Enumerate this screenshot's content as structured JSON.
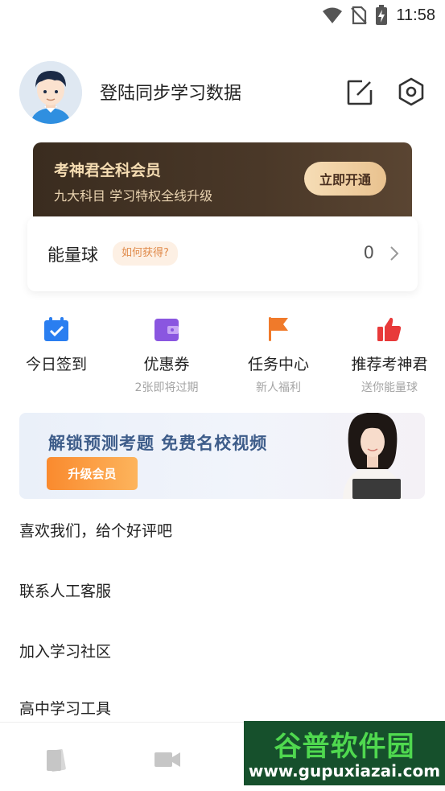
{
  "status_bar": {
    "time": "11:58",
    "icons": [
      "wifi-icon",
      "no-sim-icon",
      "battery-charging-icon"
    ]
  },
  "profile": {
    "title": "登陆同步学习数据",
    "avatar_icon": "user-avatar-icon",
    "edit_icon": "edit-icon",
    "settings_icon": "settings-icon"
  },
  "vip": {
    "title": "考神君全科会员",
    "subtitle": "九大科目 学习特权全线升级",
    "button_label": "立即开通"
  },
  "energy": {
    "label": "能量球",
    "help_label": "如何获得?",
    "value": "0"
  },
  "quick_actions": [
    {
      "label": "今日签到",
      "sub": "",
      "icon": "calendar-check-icon"
    },
    {
      "label": "优惠券",
      "sub": "2张即将过期",
      "icon": "wallet-icon"
    },
    {
      "label": "任务中心",
      "sub": "新人福利",
      "icon": "flag-icon"
    },
    {
      "label": "推荐考神君",
      "sub": "送你能量球",
      "icon": "thumbs-up-icon"
    }
  ],
  "promo": {
    "title": "解锁预测考题  免费名校视频",
    "button_label": "升级会员"
  },
  "menu": [
    "喜欢我们，给个好评吧",
    "联系人工客服",
    "加入学习社区",
    "高中学习工具"
  ],
  "tabbar": {
    "tabs": [
      "book-icon",
      "video-icon"
    ]
  },
  "watermark": {
    "title": "谷普软件园",
    "url": "www.gupuxiazai.com"
  },
  "colors": {
    "vip_bg": "#3a2c1f",
    "vip_text": "#f5dcb2",
    "promo_text": "#3e5d8a",
    "promo_button": "#fa8a2e",
    "energy_help": "#e08a4a",
    "watermark_bg": "#16502c",
    "watermark_text": "#4fd84f"
  }
}
